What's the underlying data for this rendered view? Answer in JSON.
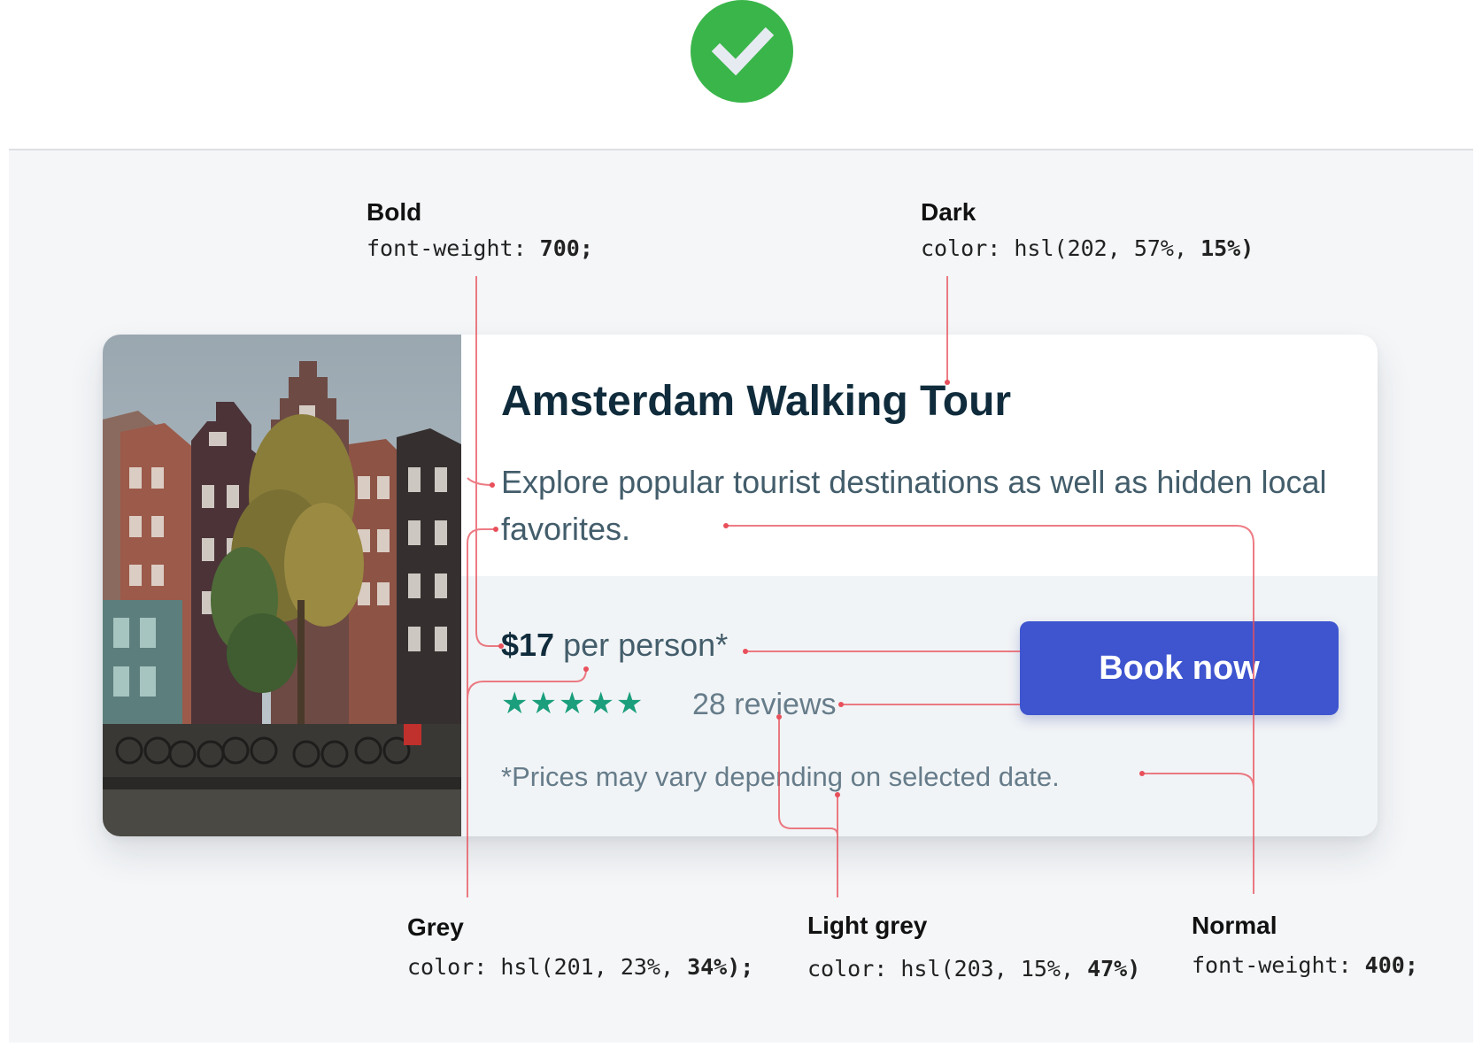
{
  "status_icon": "check-circle-icon",
  "card": {
    "title": "Amsterdam Walking Tour",
    "description": "Explore popular tourist destinations as well as hidden local favorites.",
    "price_amount": "$17",
    "price_unit": "per person*",
    "stars": "★★★★★",
    "rating_stars": 5,
    "reviews": "28 reviews",
    "note": "*Prices may vary depending on selected date.",
    "button_label": "Book now"
  },
  "annotations": {
    "bold": {
      "title": "Bold",
      "code_prefix": "font-weight: ",
      "code_value": "700;"
    },
    "dark": {
      "title": "Dark",
      "code_prefix": "color: hsl(202, 57%, ",
      "code_value": "15%)"
    },
    "grey": {
      "title": "Grey",
      "code_prefix": "color: hsl(201, 23%, ",
      "code_value": "34%);"
    },
    "light_grey": {
      "title": "Light grey",
      "code_prefix": "color: hsl(203, 15%, ",
      "code_value": "47%)"
    },
    "normal": {
      "title": "Normal",
      "code_prefix": "font-weight: ",
      "code_value": "400;"
    }
  },
  "colors": {
    "check_green": "#3ab54a",
    "dark_text": "hsl(202, 57%, 15%)",
    "grey_text": "hsl(201, 23%, 34%)",
    "light_grey_text": "hsl(203, 15%, 47%)",
    "button": "#3e55cf",
    "stars": "#1a9e7c",
    "callout_line": "#e8505b"
  }
}
